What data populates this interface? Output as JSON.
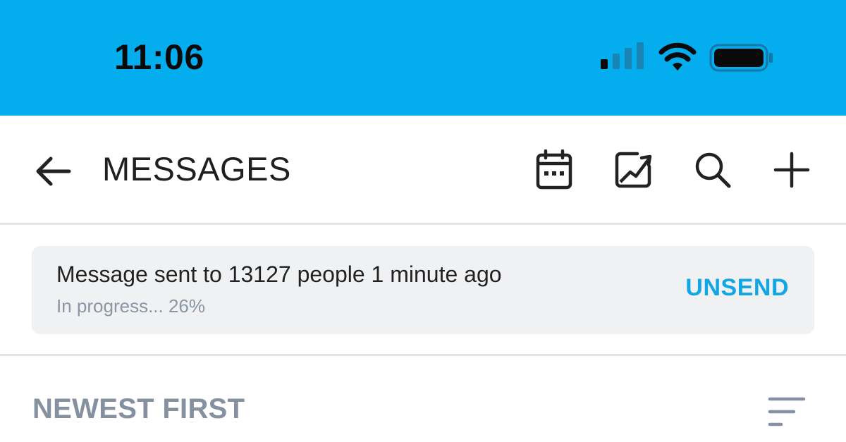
{
  "status_bar": {
    "time": "11:06",
    "color": "#03adee",
    "icons": [
      "signal-icon",
      "wifi-icon",
      "battery-icon"
    ]
  },
  "header": {
    "title": "MESSAGES",
    "back_icon": "arrow-left-icon",
    "actions": [
      "calendar-icon",
      "chart-image-icon",
      "search-icon",
      "plus-icon"
    ]
  },
  "notice": {
    "message": "Message sent to 13127 people 1 minute ago",
    "progress_text": "In progress... 26%",
    "progress_value": 0.26,
    "action_label": "UNSEND",
    "accent_color": "#13a6e5"
  },
  "list": {
    "sort_label": "NEWEST FIRST",
    "sort_icon": "sort-lines-icon"
  }
}
